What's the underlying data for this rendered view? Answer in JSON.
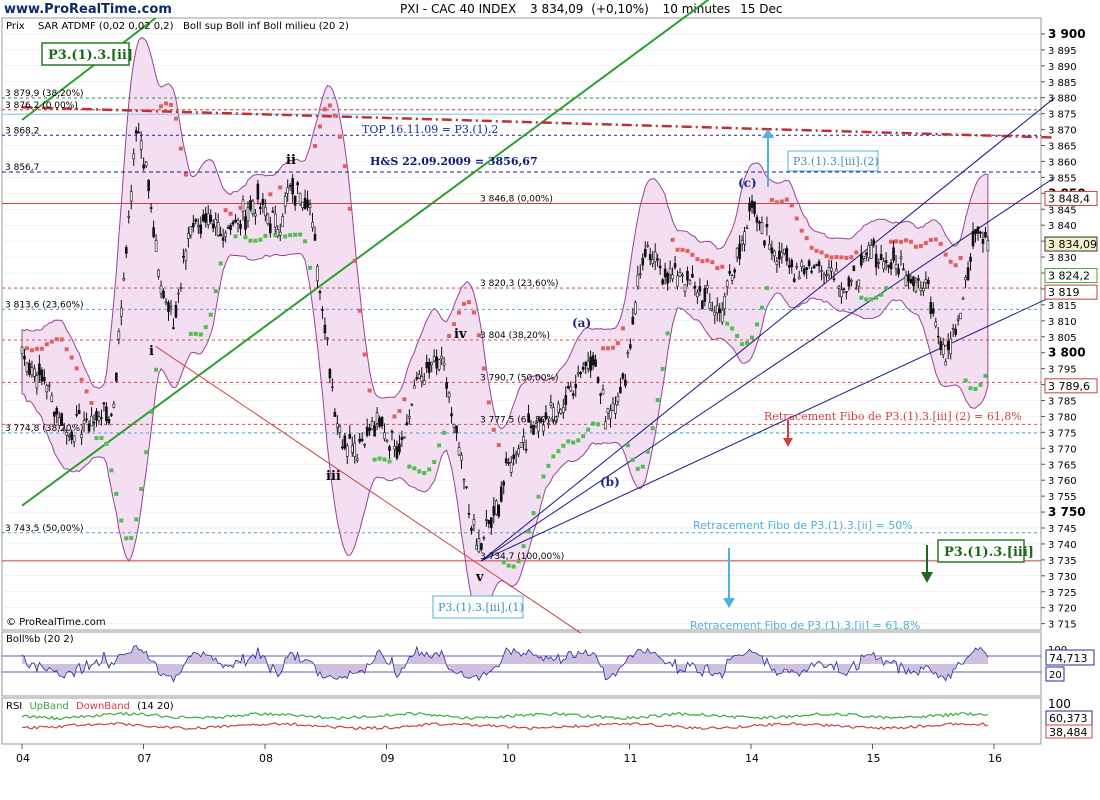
{
  "header": {
    "site": "www.ProRealTime.com",
    "title": "PXI - CAC 40 INDEX",
    "price": "3 834,09",
    "change": "(+0,10%)",
    "period": "10 minutes",
    "date": "15 Dec"
  },
  "price_panel": {
    "label": "Prix",
    "legend_sar": "SAR ATDMF (0,02 0,02 0,2)",
    "legend_boll": "Boll sup Boll inf Boll milieu (20 2)",
    "copyright": "© ProRealTime.com"
  },
  "bollb_panel": {
    "label": "Boll%b (20 2)",
    "value": "74,713",
    "ticks": [
      "100",
      "20"
    ]
  },
  "rsi_panel": {
    "label": "RSI",
    "upband": "UpBand",
    "downband": "DownBand",
    "params": "(14 20)",
    "value1": "60,373",
    "value2": "38,484",
    "ticks": [
      "100"
    ]
  },
  "annotations": {
    "box_ii": "P3.(1).3.[ii]",
    "box_iii_top": "P3.(1).3.[iii].(2)",
    "box_iii_1": "P3.(1).3.[iii].(1)",
    "box_iii": "P3.(1).3.[iii]",
    "top": "TOP 16.11.09 = P3.(1).2",
    "hs": "H&S 22.09.2009 = 3856,67",
    "retr_red": "Retracement Fibo de P3.(1).3.[iii] (2) = 61,8%",
    "retr_blue1": "Retracement Fibo de P3.(1).3.[ii] = 50%",
    "retr_blue2": "Retracement Fibo de P3.(1).3.[ii] = 61,8%",
    "wave_i": "i",
    "wave_ii": "ii",
    "wave_iii": "iii",
    "wave_iv": "iv",
    "wave_v": "v",
    "wave_a": "(a)",
    "wave_b": "(b)",
    "wave_c": "(c)"
  },
  "level_labels": [
    {
      "text": "3 879,9 (38,20%)",
      "price": 3879.9,
      "side": "left"
    },
    {
      "text": "3 876,2 (0,00%)",
      "price": 3876.2,
      "side": "left"
    },
    {
      "text": "3 868,2",
      "price": 3868.2,
      "side": "left"
    },
    {
      "text": "3 856,7",
      "price": 3856.7,
      "side": "left"
    },
    {
      "text": "3 813,6 (23,60%)",
      "price": 3813.6,
      "side": "left"
    },
    {
      "text": "3 774,8 (38,20%)",
      "price": 3774.8,
      "side": "left"
    },
    {
      "text": "3 743,5 (50,00%)",
      "price": 3743.5,
      "side": "left"
    },
    {
      "text": "3 846,8 (0,00%)",
      "price": 3846.8,
      "side": "mid"
    },
    {
      "text": "3 820,3 (23,60%)",
      "price": 3820.3,
      "side": "mid"
    },
    {
      "text": "3 804 (38,20%)",
      "price": 3804,
      "side": "mid"
    },
    {
      "text": "3 790,7 (50,00%)",
      "price": 3790.7,
      "side": "mid"
    },
    {
      "text": "3 777,5 (61,80%)",
      "price": 3777.5,
      "side": "mid"
    },
    {
      "text": "3 734,7 (100,00%)",
      "price": 3734.7,
      "side": "mid"
    }
  ],
  "price_tags": [
    {
      "text": "3 848,4",
      "price": 3848.4,
      "style": "outline"
    },
    {
      "text": "3 834,09",
      "price": 3834.09,
      "style": "filled"
    },
    {
      "text": "3 824,2",
      "price": 3824.2,
      "style": "green"
    },
    {
      "text": "3 819",
      "price": 3819,
      "style": "outline"
    },
    {
      "text": "3 789,6",
      "price": 3789.6,
      "style": "outline"
    }
  ],
  "chart_data": {
    "type": "candlestick",
    "title": "PXI - CAC 40 INDEX",
    "x_ticks": [
      "04",
      "07",
      "08",
      "09",
      "10",
      "11",
      "14",
      "15",
      "16"
    ],
    "y_ticks": [
      3715,
      3720,
      3725,
      3730,
      3735,
      3740,
      3745,
      3750,
      3755,
      3760,
      3765,
      3770,
      3775,
      3780,
      3785,
      3790,
      3795,
      3800,
      3805,
      3810,
      3815,
      3820,
      3825,
      3830,
      3835,
      3840,
      3845,
      3850,
      3855,
      3860,
      3865,
      3870,
      3875,
      3880,
      3885,
      3890,
      3895,
      3900
    ],
    "y_tick_labels": [
      "3 715",
      "3 720",
      "3 725",
      "3 730",
      "3 735",
      "3 740",
      "3 745",
      "3 750",
      "3 755",
      "3 760",
      "3 765",
      "3 770",
      "3 775",
      "3 780",
      "3 785",
      "3 790",
      "3 795",
      "3 800",
      "3 805",
      "3 810",
      "3 815",
      "3 820",
      "3 825",
      "3 830",
      "3 835",
      "3 840",
      "3 845",
      "3 850",
      "3 855",
      "3 860",
      "3 865",
      "3 870",
      "3 875",
      "3 880",
      "3 885",
      "3 890",
      "3 895",
      "3 900"
    ],
    "ylim": [
      3713,
      3905
    ],
    "price_path": [
      {
        "x": 0.0,
        "y": 3800
      },
      {
        "x": 0.2,
        "y": 3790
      },
      {
        "x": 0.35,
        "y": 3776
      },
      {
        "x": 0.55,
        "y": 3778
      },
      {
        "x": 0.75,
        "y": 3782
      },
      {
        "x": 0.85,
        "y": 3830
      },
      {
        "x": 0.95,
        "y": 3872
      },
      {
        "x": 1.05,
        "y": 3850
      },
      {
        "x": 1.15,
        "y": 3820
      },
      {
        "x": 1.25,
        "y": 3810
      },
      {
        "x": 1.4,
        "y": 3842
      },
      {
        "x": 1.6,
        "y": 3838
      },
      {
        "x": 1.8,
        "y": 3842
      },
      {
        "x": 1.95,
        "y": 3848
      },
      {
        "x": 2.1,
        "y": 3838
      },
      {
        "x": 2.2,
        "y": 3850
      },
      {
        "x": 2.35,
        "y": 3850
      },
      {
        "x": 2.45,
        "y": 3822
      },
      {
        "x": 2.6,
        "y": 3776
      },
      {
        "x": 2.75,
        "y": 3770
      },
      {
        "x": 2.95,
        "y": 3778
      },
      {
        "x": 3.1,
        "y": 3770
      },
      {
        "x": 3.25,
        "y": 3790
      },
      {
        "x": 3.45,
        "y": 3798
      },
      {
        "x": 3.6,
        "y": 3768
      },
      {
        "x": 3.75,
        "y": 3738
      },
      {
        "x": 3.9,
        "y": 3750
      },
      {
        "x": 4.0,
        "y": 3765
      },
      {
        "x": 4.2,
        "y": 3778
      },
      {
        "x": 4.4,
        "y": 3780
      },
      {
        "x": 4.6,
        "y": 3795
      },
      {
        "x": 4.7,
        "y": 3800
      },
      {
        "x": 4.8,
        "y": 3780
      },
      {
        "x": 4.95,
        "y": 3790
      },
      {
        "x": 5.1,
        "y": 3830
      },
      {
        "x": 5.3,
        "y": 3826
      },
      {
        "x": 5.5,
        "y": 3822
      },
      {
        "x": 5.75,
        "y": 3812
      },
      {
        "x": 6.0,
        "y": 3845
      },
      {
        "x": 6.2,
        "y": 3832
      },
      {
        "x": 6.4,
        "y": 3826
      },
      {
        "x": 6.6,
        "y": 3828
      },
      {
        "x": 6.8,
        "y": 3820
      },
      {
        "x": 7.0,
        "y": 3832
      },
      {
        "x": 7.2,
        "y": 3828
      },
      {
        "x": 7.45,
        "y": 3820
      },
      {
        "x": 7.6,
        "y": 3800
      },
      {
        "x": 7.75,
        "y": 3815
      },
      {
        "x": 7.85,
        "y": 3840
      },
      {
        "x": 7.95,
        "y": 3834
      }
    ],
    "x_tick_positions": [
      0,
      1,
      2,
      3,
      4,
      5,
      6,
      7,
      8
    ],
    "hlines": [
      {
        "price": 3879.9,
        "color": "#2e8b57",
        "dash": "3,3"
      },
      {
        "price": 3876.2,
        "color": "#cc3333",
        "dash": "3,3"
      },
      {
        "price": 3874.8,
        "color": "#88c8e8",
        "dash": ""
      },
      {
        "price": 3868.2,
        "color": "#2020a0",
        "dash": "3,3"
      },
      {
        "price": 3856.7,
        "color": "#1a1aa0",
        "dash": "4,3"
      },
      {
        "price": 3846.8,
        "color": "#c84040",
        "dash": ""
      },
      {
        "price": 3820.3,
        "color": "#d05050",
        "dash": "3,3"
      },
      {
        "price": 3813.6,
        "color": "#50a0d0",
        "dash": "3,3"
      },
      {
        "price": 3804,
        "color": "#d05050",
        "dash": "3,3"
      },
      {
        "price": 3790.7,
        "color": "#d05050",
        "dash": "3,3"
      },
      {
        "price": 3777.5,
        "color": "#d05050",
        "dash": "3,3"
      },
      {
        "price": 3774.8,
        "color": "#50a0d0",
        "dash": "3,3"
      },
      {
        "price": 3743.5,
        "color": "#50a0d0",
        "dash": "3,3"
      },
      {
        "price": 3734.7,
        "color": "#c84040",
        "dash": ""
      }
    ],
    "trendlines": [
      {
        "x1": 0.0,
        "y1": 3752,
        "x2": 5.8,
        "y2": 3915,
        "color": "#2ca02c",
        "width": 2
      },
      {
        "x1": 0.0,
        "y1": 3873,
        "x2": 1.1,
        "y2": 3905,
        "color": "#2ca02c",
        "width": 2
      },
      {
        "x1": 0.0,
        "y1": 3877,
        "x2": 8.5,
        "y2": 3867.5,
        "color": "#c03030",
        "width": 2.5,
        "dash": "10,4,2,4"
      },
      {
        "x1": 1.1,
        "y1": 3802,
        "x2": 4.6,
        "y2": 3712,
        "color": "#d04040",
        "width": 1
      },
      {
        "x1": 3.78,
        "y1": 3734.7,
        "x2": 8.5,
        "y2": 3880,
        "color": "#1a1a80",
        "width": 1
      },
      {
        "x1": 3.78,
        "y1": 3734.7,
        "x2": 8.5,
        "y2": 3855,
        "color": "#1a1a80",
        "width": 1
      },
      {
        "x1": 3.78,
        "y1": 3734.7,
        "x2": 8.5,
        "y2": 3818,
        "color": "#1a1a80",
        "width": 1
      }
    ],
    "colors": {
      "candle": "#111111",
      "band_fill": "#f2dcf0",
      "band_line": "#8b2f8b",
      "sar_up": "#4fbf4f",
      "sar_down": "#e06060",
      "grid": "#e4e4e4"
    }
  }
}
